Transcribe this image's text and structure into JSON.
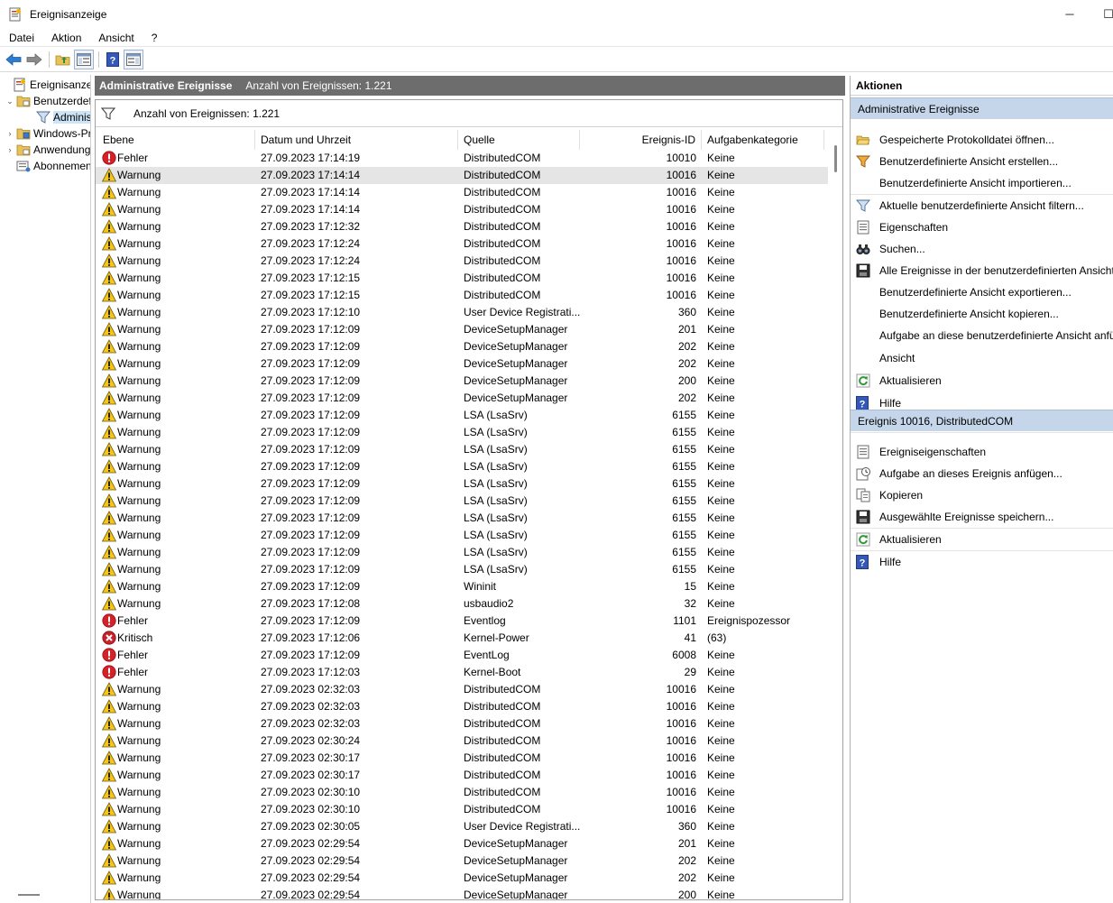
{
  "window": {
    "title": "Ereignisanzeige",
    "minimize_glyph": "─",
    "maximize_glyph": "☐"
  },
  "menu": [
    "Datei",
    "Aktion",
    "Ansicht",
    "?"
  ],
  "toolbar": {
    "icons": [
      "back-arrow-icon",
      "forward-arrow-icon",
      "folder-up-icon",
      "show-hide-tree-icon",
      "help-icon",
      "show-hide-action-pane-icon"
    ]
  },
  "tree": {
    "items": [
      {
        "label": "Ereignisanzeige (Lokal)",
        "icon": "event-viewer-icon",
        "expander": ""
      },
      {
        "label": "Benutzerdefinierte Ansichten",
        "icon": "folder-icon",
        "expander": "⌄"
      },
      {
        "label": "Administrative Ereignisse",
        "icon": "filter-icon",
        "expander": ""
      },
      {
        "label": "Windows-Protokolle",
        "icon": "folder-icon",
        "expander": "›"
      },
      {
        "label": "Anwendungs- und Dienstprotokolle",
        "icon": "folder-icon",
        "expander": "›"
      },
      {
        "label": "Abonnements",
        "icon": "subscriptions-icon",
        "expander": ""
      }
    ]
  },
  "center": {
    "header_title": "Administrative Ereignisse",
    "header_count": "Anzahl von Ereignissen: 1.221",
    "filter_text": "Anzahl von Ereignissen: 1.221",
    "columns": [
      "Ebene",
      "Datum und Uhrzeit",
      "Quelle",
      "Ereignis-ID",
      "Aufgabenkategorie"
    ],
    "selected_row": 1,
    "rows": [
      [
        "Fehler",
        "27.09.2023 17:14:19",
        "DistributedCOM",
        "10010",
        "Keine"
      ],
      [
        "Warnung",
        "27.09.2023 17:14:14",
        "DistributedCOM",
        "10016",
        "Keine"
      ],
      [
        "Warnung",
        "27.09.2023 17:14:14",
        "DistributedCOM",
        "10016",
        "Keine"
      ],
      [
        "Warnung",
        "27.09.2023 17:14:14",
        "DistributedCOM",
        "10016",
        "Keine"
      ],
      [
        "Warnung",
        "27.09.2023 17:12:32",
        "DistributedCOM",
        "10016",
        "Keine"
      ],
      [
        "Warnung",
        "27.09.2023 17:12:24",
        "DistributedCOM",
        "10016",
        "Keine"
      ],
      [
        "Warnung",
        "27.09.2023 17:12:24",
        "DistributedCOM",
        "10016",
        "Keine"
      ],
      [
        "Warnung",
        "27.09.2023 17:12:15",
        "DistributedCOM",
        "10016",
        "Keine"
      ],
      [
        "Warnung",
        "27.09.2023 17:12:15",
        "DistributedCOM",
        "10016",
        "Keine"
      ],
      [
        "Warnung",
        "27.09.2023 17:12:10",
        "User Device Registrati...",
        "360",
        "Keine"
      ],
      [
        "Warnung",
        "27.09.2023 17:12:09",
        "DeviceSetupManager",
        "201",
        "Keine"
      ],
      [
        "Warnung",
        "27.09.2023 17:12:09",
        "DeviceSetupManager",
        "202",
        "Keine"
      ],
      [
        "Warnung",
        "27.09.2023 17:12:09",
        "DeviceSetupManager",
        "202",
        "Keine"
      ],
      [
        "Warnung",
        "27.09.2023 17:12:09",
        "DeviceSetupManager",
        "200",
        "Keine"
      ],
      [
        "Warnung",
        "27.09.2023 17:12:09",
        "DeviceSetupManager",
        "202",
        "Keine"
      ],
      [
        "Warnung",
        "27.09.2023 17:12:09",
        "LSA (LsaSrv)",
        "6155",
        "Keine"
      ],
      [
        "Warnung",
        "27.09.2023 17:12:09",
        "LSA (LsaSrv)",
        "6155",
        "Keine"
      ],
      [
        "Warnung",
        "27.09.2023 17:12:09",
        "LSA (LsaSrv)",
        "6155",
        "Keine"
      ],
      [
        "Warnung",
        "27.09.2023 17:12:09",
        "LSA (LsaSrv)",
        "6155",
        "Keine"
      ],
      [
        "Warnung",
        "27.09.2023 17:12:09",
        "LSA (LsaSrv)",
        "6155",
        "Keine"
      ],
      [
        "Warnung",
        "27.09.2023 17:12:09",
        "LSA (LsaSrv)",
        "6155",
        "Keine"
      ],
      [
        "Warnung",
        "27.09.2023 17:12:09",
        "LSA (LsaSrv)",
        "6155",
        "Keine"
      ],
      [
        "Warnung",
        "27.09.2023 17:12:09",
        "LSA (LsaSrv)",
        "6155",
        "Keine"
      ],
      [
        "Warnung",
        "27.09.2023 17:12:09",
        "LSA (LsaSrv)",
        "6155",
        "Keine"
      ],
      [
        "Warnung",
        "27.09.2023 17:12:09",
        "LSA (LsaSrv)",
        "6155",
        "Keine"
      ],
      [
        "Warnung",
        "27.09.2023 17:12:09",
        "Wininit",
        "15",
        "Keine"
      ],
      [
        "Warnung",
        "27.09.2023 17:12:08",
        "usbaudio2",
        "32",
        "Keine"
      ],
      [
        "Fehler",
        "27.09.2023 17:12:09",
        "Eventlog",
        "1101",
        "Ereignispozessor"
      ],
      [
        "Kritisch",
        "27.09.2023 17:12:06",
        "Kernel-Power",
        "41",
        "(63)"
      ],
      [
        "Fehler",
        "27.09.2023 17:12:09",
        "EventLog",
        "6008",
        "Keine"
      ],
      [
        "Fehler",
        "27.09.2023 17:12:03",
        "Kernel-Boot",
        "29",
        "Keine"
      ],
      [
        "Warnung",
        "27.09.2023 02:32:03",
        "DistributedCOM",
        "10016",
        "Keine"
      ],
      [
        "Warnung",
        "27.09.2023 02:32:03",
        "DistributedCOM",
        "10016",
        "Keine"
      ],
      [
        "Warnung",
        "27.09.2023 02:32:03",
        "DistributedCOM",
        "10016",
        "Keine"
      ],
      [
        "Warnung",
        "27.09.2023 02:30:24",
        "DistributedCOM",
        "10016",
        "Keine"
      ],
      [
        "Warnung",
        "27.09.2023 02:30:17",
        "DistributedCOM",
        "10016",
        "Keine"
      ],
      [
        "Warnung",
        "27.09.2023 02:30:17",
        "DistributedCOM",
        "10016",
        "Keine"
      ],
      [
        "Warnung",
        "27.09.2023 02:30:10",
        "DistributedCOM",
        "10016",
        "Keine"
      ],
      [
        "Warnung",
        "27.09.2023 02:30:10",
        "DistributedCOM",
        "10016",
        "Keine"
      ],
      [
        "Warnung",
        "27.09.2023 02:30:05",
        "User Device Registrati...",
        "360",
        "Keine"
      ],
      [
        "Warnung",
        "27.09.2023 02:29:54",
        "DeviceSetupManager",
        "201",
        "Keine"
      ],
      [
        "Warnung",
        "27.09.2023 02:29:54",
        "DeviceSetupManager",
        "202",
        "Keine"
      ],
      [
        "Warnung",
        "27.09.2023 02:29:54",
        "DeviceSetupManager",
        "202",
        "Keine"
      ],
      [
        "Warnung",
        "27.09.2023 02:29:54",
        "DeviceSetupManager",
        "200",
        "Keine"
      ]
    ]
  },
  "actions": {
    "title": "Aktionen",
    "sections": [
      {
        "title": "Administrative Ereignisse",
        "items": [
          {
            "label": "Gespeicherte Protokolldatei öffnen...",
            "icon": "open-folder-icon"
          },
          {
            "label": "Benutzerdefinierte Ansicht erstellen...",
            "icon": "create-filter-icon"
          },
          {
            "label": "Benutzerdefinierte Ansicht importieren...",
            "icon": ""
          },
          {
            "label": "Aktuelle benutzerdefinierte Ansicht filtern...",
            "icon": "filter-icon"
          },
          {
            "label": "Eigenschaften",
            "icon": "properties-icon"
          },
          {
            "label": "Suchen...",
            "icon": "binoculars-icon"
          },
          {
            "label": "Alle Ereignisse in der benutzerdefinierten Ansicht speichern unter...",
            "icon": "save-icon"
          },
          {
            "label": "Benutzerdefinierte Ansicht exportieren...",
            "icon": ""
          },
          {
            "label": "Benutzerdefinierte Ansicht kopieren...",
            "icon": ""
          },
          {
            "label": "Aufgabe an diese benutzerdefinierte Ansicht anfügen...",
            "icon": ""
          },
          {
            "label": "Ansicht",
            "icon": ""
          },
          {
            "label": "Aktualisieren",
            "icon": "refresh-icon"
          },
          {
            "label": "Hilfe",
            "icon": "help-icon"
          }
        ]
      },
      {
        "title": "Ereignis 10016, DistributedCOM",
        "items": [
          {
            "label": "Ereigniseigenschaften",
            "icon": "properties-icon"
          },
          {
            "label": "Aufgabe an dieses Ereignis anfügen...",
            "icon": "attach-task-icon"
          },
          {
            "label": "Kopieren",
            "icon": "copy-icon"
          },
          {
            "label": "Ausgewählte Ereignisse speichern...",
            "icon": "save-icon"
          },
          {
            "label": "Aktualisieren",
            "icon": "refresh-icon"
          },
          {
            "label": "Hilfe",
            "icon": "help-icon"
          }
        ]
      }
    ]
  },
  "colors": {
    "header_gray": "#6d6d6d",
    "section_blue": "#c5d6ea",
    "selected_row": "#e5e5e5",
    "error_red": "#d2222a",
    "warning_yellow": "#f5c518"
  }
}
